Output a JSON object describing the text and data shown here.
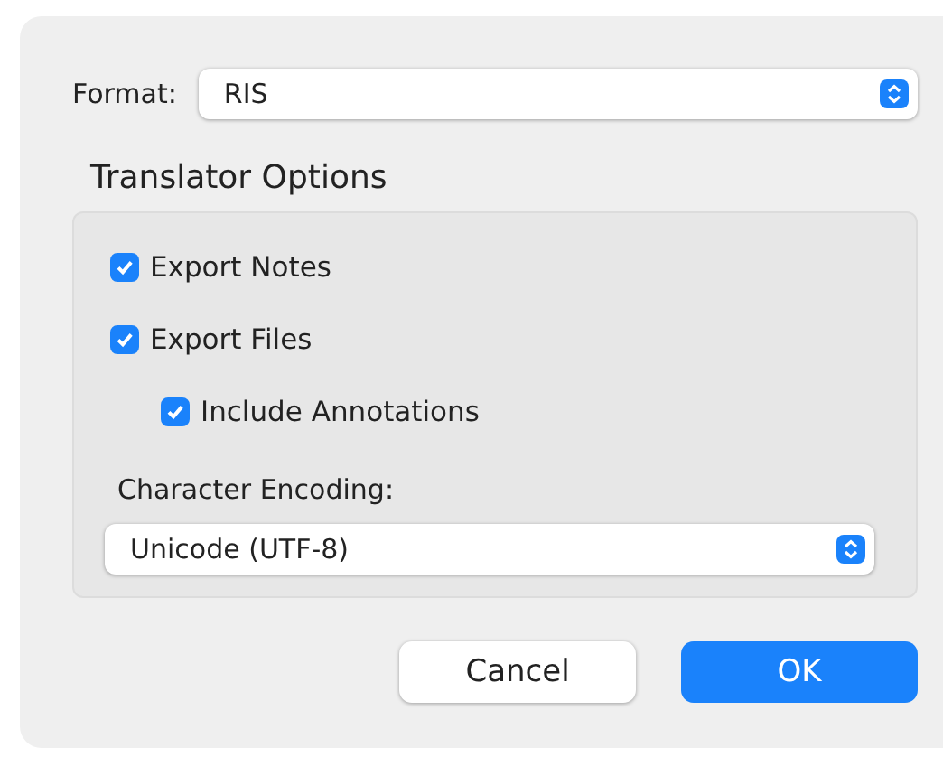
{
  "format": {
    "label": "Format:",
    "value": "RIS"
  },
  "translator_options": {
    "title": "Translator Options",
    "options": [
      {
        "label": "Export Notes",
        "checked": true
      },
      {
        "label": "Export Files",
        "checked": true,
        "children": [
          {
            "label": "Include Annotations",
            "checked": true
          }
        ]
      }
    ],
    "encoding": {
      "label": "Character Encoding:",
      "value": "Unicode (UTF-8)"
    }
  },
  "buttons": [
    {
      "label": "Cancel",
      "kind": "secondary"
    },
    {
      "label": "OK",
      "kind": "default"
    }
  ]
}
